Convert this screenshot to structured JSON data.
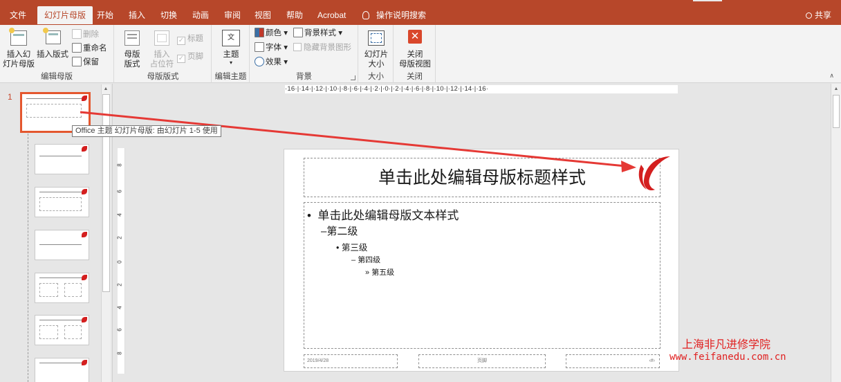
{
  "tabs": [
    "文件",
    "幻灯片母版",
    "开始",
    "插入",
    "切换",
    "动画",
    "审阅",
    "视图",
    "帮助",
    "Acrobat"
  ],
  "active_tab": "幻灯片母版",
  "tell_me": "操作说明搜索",
  "share": "共享",
  "ribbon": {
    "edit_master": {
      "label": "编辑母版",
      "insert_slide_master": "插入幻\n灯片母版",
      "insert_layout": "插入版式",
      "delete": "删除",
      "rename": "重命名",
      "preserve": "保留"
    },
    "master_layout": {
      "label": "母版版式",
      "master_layout_btn": "母版\n版式",
      "insert_placeholder": "插入\n占位符",
      "title": "标题",
      "footers": "页脚"
    },
    "edit_theme": {
      "label": "编辑主题",
      "themes": "主题"
    },
    "background": {
      "label": "背景",
      "colors": "颜色",
      "fonts": "字体",
      "effects": "效果",
      "background_styles": "背景样式",
      "hide_background": "隐藏背景图形"
    },
    "size": {
      "label": "大小",
      "slide_size": "幻灯片\n大小"
    },
    "close": {
      "label": "关闭",
      "close_master": "关闭\n母版视图"
    }
  },
  "thumbs": {
    "selected_number": "1",
    "tooltip": "Office 主题 幻灯片母版: 由幻灯片 1-5 使用"
  },
  "ruler": "·16·|·14·|·12·|·10·|·8·|·6·|·4·|·2·|·0·|·2·|·4·|·6·|·8·|·10·|·12·|·14·|·16·",
  "vruler": [
    "8",
    "6",
    "4",
    "2",
    "0",
    "2",
    "4",
    "6",
    "8"
  ],
  "slide": {
    "title": "单击此处编辑母版标题样式",
    "level1": "单击此处编辑母版文本样式",
    "level2": "第二级",
    "level3": "第三级",
    "level4": "第四级",
    "level5": "第五级",
    "date": "2019/4/28",
    "footer": "页脚",
    "number": "‹#›"
  },
  "watermark": {
    "line1": "上海非凡进修学院",
    "line2": "www.feifanedu.com.cn"
  },
  "colors": {
    "accent": "#b7472a",
    "selection": "#e4572e",
    "arrow": "#e53935"
  }
}
